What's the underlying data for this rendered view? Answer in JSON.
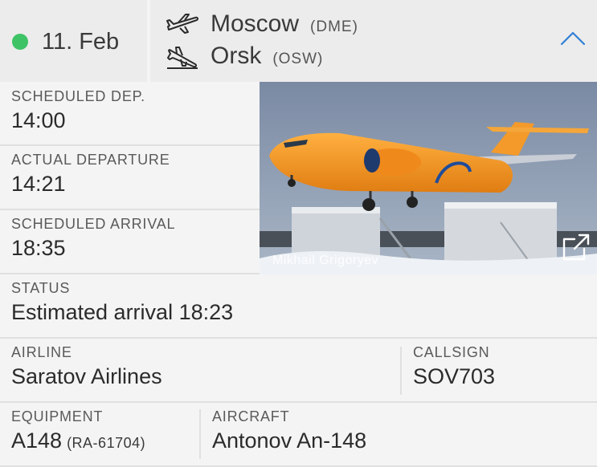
{
  "header": {
    "date": "11. Feb",
    "status_color": "#3ec366",
    "departure": {
      "city": "Moscow",
      "code": "(DME)",
      "icon": "takeoff-icon"
    },
    "arrival": {
      "city": "Orsk",
      "code": "(OSW)",
      "icon": "landing-icon"
    },
    "toggle_icon": "chevron-up-icon"
  },
  "photo": {
    "credit": "Mikhail Grigoryev",
    "expand_icon": "external-link-icon"
  },
  "fields": {
    "scheduled_dep": {
      "label": "SCHEDULED DEP.",
      "value": "14:00"
    },
    "actual_dep": {
      "label": "ACTUAL DEPARTURE",
      "value": "14:21"
    },
    "scheduled_arr": {
      "label": "SCHEDULED ARRIVAL",
      "value": "18:35"
    },
    "status": {
      "label": "STATUS",
      "value": "Estimated arrival 18:23"
    },
    "airline": {
      "label": "AIRLINE",
      "value": "Saratov Airlines"
    },
    "callsign": {
      "label": "CALLSIGN",
      "value": "SOV703"
    },
    "equipment": {
      "label": "EQUIPMENT",
      "value": "A148",
      "registration": "(RA-61704)"
    },
    "aircraft": {
      "label": "AIRCRAFT",
      "value": "Antonov An-148"
    }
  },
  "colors": {
    "accent": "#2f7fd6",
    "status_green": "#3ec366",
    "plane_orange": "#f39a2a"
  }
}
